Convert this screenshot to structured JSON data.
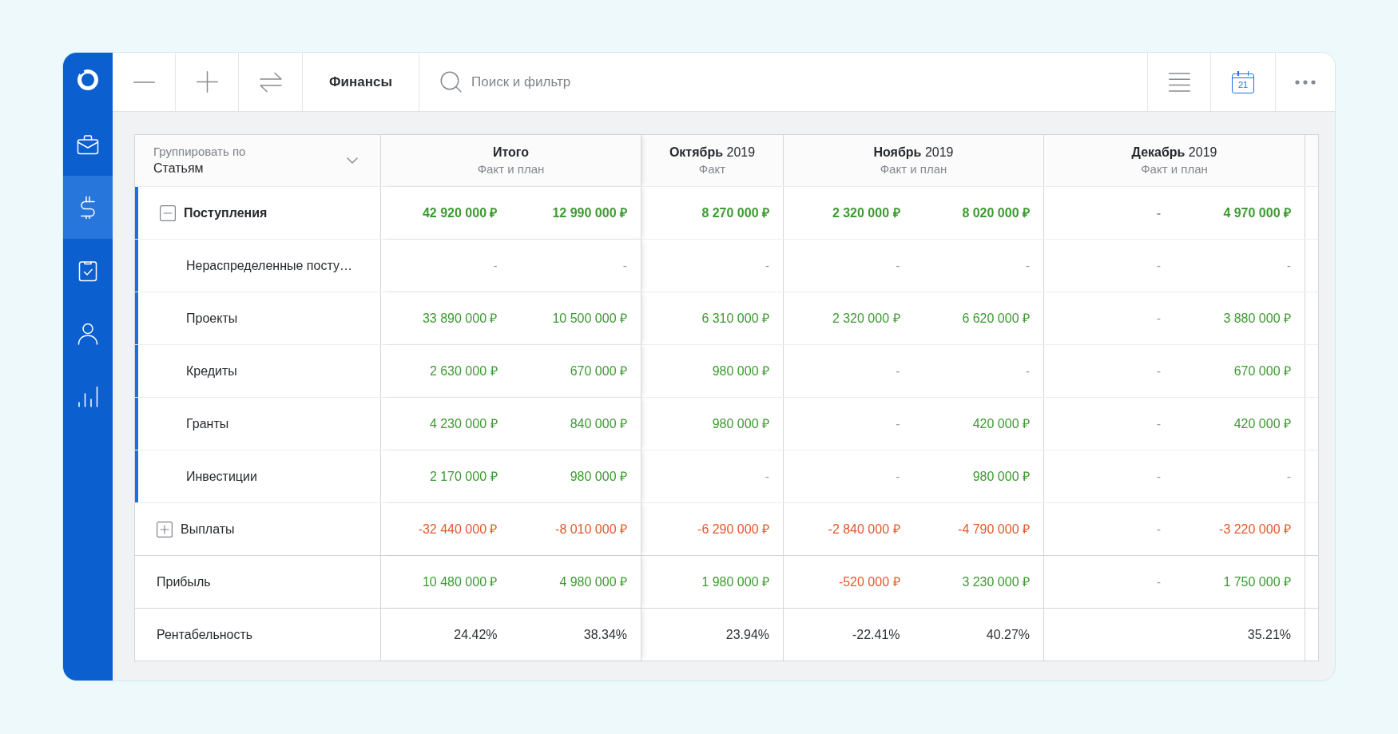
{
  "sidebar": {
    "items": [
      {
        "selected": false
      },
      {
        "selected": true
      },
      {
        "selected": false
      },
      {
        "selected": false
      },
      {
        "selected": false
      }
    ]
  },
  "toolbar": {
    "title": "Финансы",
    "search": {
      "placeholder": "Поиск и фильтр"
    },
    "calendar_day": "21"
  },
  "table": {
    "group_by": {
      "label": "Группировать по",
      "value": "Статьям"
    },
    "columns": [
      {
        "kind": "total",
        "title": "Итого",
        "subtitle": "Факт и план"
      },
      {
        "kind": "month",
        "title": "**Октябрь** 2019",
        "subtitle": "Факт"
      },
      {
        "kind": "month",
        "title": "**Ноябрь** 2019",
        "subtitle": "Факт и план"
      },
      {
        "kind": "month",
        "title": "**Декабрь** 2019",
        "subtitle": "Факт и план"
      }
    ],
    "rows": [
      {
        "kind": "group",
        "label": "Поступления",
        "expanded": true,
        "cells": [
          [
            {
              "text": "42 920 000 ₽",
              "kind": "positive"
            },
            {
              "text": "12 990 000 ₽",
              "kind": "positive"
            }
          ],
          [
            {
              "text": "8 270 000 ₽",
              "kind": "positive"
            }
          ],
          [
            {
              "text": "2 320 000 ₽",
              "kind": "positive"
            },
            {
              "text": "8 020 000 ₽",
              "kind": "positive"
            }
          ],
          [
            {
              "text": "-",
              "kind": "empty"
            },
            {
              "text": "4 970 000 ₽",
              "kind": "positive"
            }
          ]
        ],
        "children": [
          {
            "kind": "item",
            "label": "Нераспределенные посту…",
            "cells": [
              [
                {
                  "text": "-",
                  "kind": "empty"
                },
                {
                  "text": "-",
                  "kind": "empty"
                }
              ],
              [
                {
                  "text": "-",
                  "kind": "empty"
                }
              ],
              [
                {
                  "text": "-",
                  "kind": "empty"
                },
                {
                  "text": "-",
                  "kind": "empty"
                }
              ],
              [
                {
                  "text": "-",
                  "kind": "empty"
                },
                {
                  "text": "-",
                  "kind": "empty"
                }
              ]
            ]
          },
          {
            "kind": "item",
            "label": "Проекты",
            "cells": [
              [
                {
                  "text": "33 890 000 ₽",
                  "kind": "positive"
                },
                {
                  "text": "10 500 000 ₽",
                  "kind": "positive"
                }
              ],
              [
                {
                  "text": "6 310 000 ₽",
                  "kind": "positive"
                }
              ],
              [
                {
                  "text": "2 320 000 ₽",
                  "kind": "positive"
                },
                {
                  "text": "6 620 000 ₽",
                  "kind": "positive"
                }
              ],
              [
                {
                  "text": "-",
                  "kind": "empty"
                },
                {
                  "text": "3 880 000 ₽",
                  "kind": "positive"
                }
              ]
            ]
          },
          {
            "kind": "item",
            "label": "Кредиты",
            "cells": [
              [
                {
                  "text": "2 630 000 ₽",
                  "kind": "positive"
                },
                {
                  "text": "670 000 ₽",
                  "kind": "positive"
                }
              ],
              [
                {
                  "text": "980 000 ₽",
                  "kind": "positive"
                }
              ],
              [
                {
                  "text": "-",
                  "kind": "empty"
                },
                {
                  "text": "-",
                  "kind": "empty"
                }
              ],
              [
                {
                  "text": "-",
                  "kind": "empty"
                },
                {
                  "text": "670 000 ₽",
                  "kind": "positive"
                }
              ]
            ]
          },
          {
            "kind": "item",
            "label": "Гранты",
            "cells": [
              [
                {
                  "text": "4 230 000 ₽",
                  "kind": "positive"
                },
                {
                  "text": "840 000 ₽",
                  "kind": "positive"
                }
              ],
              [
                {
                  "text": "980 000 ₽",
                  "kind": "positive"
                }
              ],
              [
                {
                  "text": "-",
                  "kind": "empty"
                },
                {
                  "text": "420 000 ₽",
                  "kind": "positive"
                }
              ],
              [
                {
                  "text": "-",
                  "kind": "empty"
                },
                {
                  "text": "420 000 ₽",
                  "kind": "positive"
                }
              ]
            ]
          },
          {
            "kind": "item",
            "label": "Инвестиции",
            "cells": [
              [
                {
                  "text": "2 170 000 ₽",
                  "kind": "positive"
                },
                {
                  "text": "980 000 ₽",
                  "kind": "positive"
                }
              ],
              [
                {
                  "text": "-",
                  "kind": "empty"
                }
              ],
              [
                {
                  "text": "-",
                  "kind": "empty"
                },
                {
                  "text": "980 000 ₽",
                  "kind": "positive"
                }
              ],
              [
                {
                  "text": "-",
                  "kind": "empty"
                },
                {
                  "text": "-",
                  "kind": "empty"
                }
              ]
            ]
          }
        ]
      },
      {
        "kind": "group",
        "label": "Выплаты",
        "expanded": false,
        "cells": [
          [
            {
              "text": "-32 440 000 ₽",
              "kind": "negative"
            },
            {
              "text": "-8 010 000 ₽",
              "kind": "negative"
            }
          ],
          [
            {
              "text": "-6 290 000 ₽",
              "kind": "negative"
            }
          ],
          [
            {
              "text": "-2 840 000 ₽",
              "kind": "negative"
            },
            {
              "text": "-4 790 000 ₽",
              "kind": "negative"
            }
          ],
          [
            {
              "text": "-",
              "kind": "empty"
            },
            {
              "text": "-3 220 000 ₽",
              "kind": "negative"
            }
          ]
        ]
      },
      {
        "kind": "summary",
        "label": "Прибыль",
        "cells": [
          [
            {
              "text": "10 480 000 ₽",
              "kind": "positive"
            },
            {
              "text": "4 980 000 ₽",
              "kind": "positive"
            }
          ],
          [
            {
              "text": "1 980 000 ₽",
              "kind": "positive"
            }
          ],
          [
            {
              "text": "-520 000 ₽",
              "kind": "negative"
            },
            {
              "text": "3 230 000 ₽",
              "kind": "positive"
            }
          ],
          [
            {
              "text": "-",
              "kind": "empty"
            },
            {
              "text": "1 750 000 ₽",
              "kind": "positive"
            }
          ]
        ]
      },
      {
        "kind": "summary",
        "label": "Рентабельность",
        "cells": [
          [
            {
              "text": "24.42%",
              "kind": "plain"
            },
            {
              "text": "38.34%",
              "kind": "plain"
            }
          ],
          [
            {
              "text": "23.94%",
              "kind": "plain"
            }
          ],
          [
            {
              "text": "-22.41%",
              "kind": "plain"
            },
            {
              "text": "40.27%",
              "kind": "plain"
            }
          ],
          [
            null,
            {
              "text": "35.21%",
              "kind": "plain"
            }
          ]
        ]
      }
    ]
  }
}
